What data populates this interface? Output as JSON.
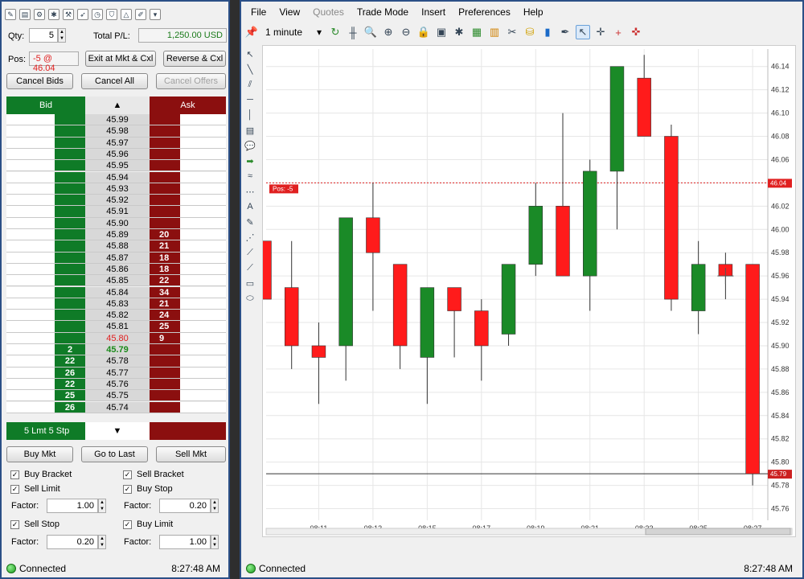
{
  "left_panel": {
    "toolbar_icons": [
      "pencil-icon",
      "document-icon",
      "gear-icon",
      "bug-icon",
      "tools-icon",
      "rocket-icon",
      "clock-icon",
      "shield-icon",
      "triangle-icon",
      "brush-icon",
      "dropdown-icon"
    ],
    "qty_label": "Qty:",
    "qty_value": "5",
    "total_pl_label": "Total P/L:",
    "total_pl_value": "1,250.00 USD",
    "pos_label": "Pos:",
    "pos_value": "-5 @ 46.04",
    "exit_button": "Exit at Mkt & Cxl",
    "reverse_button": "Reverse & Cxl",
    "cancel_bids": "Cancel Bids",
    "cancel_all": "Cancel All",
    "cancel_offers": "Cancel Offers",
    "bid_header": "Bid",
    "ask_header": "Ask",
    "up_arrow": "▲",
    "down_arrow": "▼",
    "footer_left": "5 Lmt 5 Stp",
    "ladder": [
      {
        "bid": "",
        "price": "45.99",
        "ask": ""
      },
      {
        "bid": "",
        "price": "45.98",
        "ask": ""
      },
      {
        "bid": "",
        "price": "45.97",
        "ask": ""
      },
      {
        "bid": "",
        "price": "45.96",
        "ask": ""
      },
      {
        "bid": "",
        "price": "45.95",
        "ask": ""
      },
      {
        "bid": "",
        "price": "45.94",
        "ask": ""
      },
      {
        "bid": "",
        "price": "45.93",
        "ask": ""
      },
      {
        "bid": "",
        "price": "45.92",
        "ask": ""
      },
      {
        "bid": "",
        "price": "45.91",
        "ask": ""
      },
      {
        "bid": "",
        "price": "45.90",
        "ask": ""
      },
      {
        "bid": "",
        "price": "45.89",
        "ask": "20"
      },
      {
        "bid": "",
        "price": "45.88",
        "ask": "21"
      },
      {
        "bid": "",
        "price": "45.87",
        "ask": "18"
      },
      {
        "bid": "",
        "price": "45.86",
        "ask": "18"
      },
      {
        "bid": "",
        "price": "45.85",
        "ask": "22"
      },
      {
        "bid": "",
        "price": "45.84",
        "ask": "34"
      },
      {
        "bid": "",
        "price": "45.83",
        "ask": "21"
      },
      {
        "bid": "",
        "price": "45.82",
        "ask": "24"
      },
      {
        "bid": "",
        "price": "45.81",
        "ask": "25"
      },
      {
        "bid": "",
        "price": "45.80",
        "ask": "9"
      },
      {
        "bid": "2",
        "price": "45.79",
        "ask": ""
      },
      {
        "bid": "22",
        "price": "45.78",
        "ask": ""
      },
      {
        "bid": "26",
        "price": "45.77",
        "ask": ""
      },
      {
        "bid": "22",
        "price": "45.76",
        "ask": ""
      },
      {
        "bid": "25",
        "price": "45.75",
        "ask": ""
      },
      {
        "bid": "26",
        "price": "45.74",
        "ask": ""
      }
    ],
    "buy_mkt": "Buy Mkt",
    "go_to_last": "Go to Last",
    "sell_mkt": "Sell Mkt",
    "buy_bracket": "Buy Bracket",
    "sell_bracket": "Sell Bracket",
    "sell_limit": "Sell Limit",
    "buy_stop": "Buy Stop",
    "factor_label": "Factor:",
    "factor1": "1.00",
    "factor2": "0.20",
    "sell_stop": "Sell Stop",
    "buy_limit": "Buy Limit",
    "factor3": "0.20",
    "factor4": "1.00",
    "status": "Connected",
    "time": "8:27:48 AM"
  },
  "right_panel": {
    "menu": [
      "File",
      "View",
      "Quotes",
      "Trade Mode",
      "Insert",
      "Preferences",
      "Help"
    ],
    "interval": "1 minute",
    "toolbar_icons": [
      "pin-icon",
      "refresh-icon",
      "bars-icon",
      "zoom-icon",
      "zoom-in-icon",
      "zoom-out-icon",
      "lock-icon",
      "image-icon",
      "bug-icon",
      "chart-icon",
      "grid-icon",
      "scissors-icon",
      "bucket-icon",
      "book-icon",
      "pen-icon",
      "cursor-icon",
      "crosshair-icon",
      "plus-icon",
      "target-icon"
    ],
    "side_icons": [
      "arrow-icon",
      "line-icon",
      "channel-icon",
      "hline-icon",
      "vline-icon",
      "note-icon",
      "bubble-icon",
      "green-arrow-icon",
      "wave-icon",
      "dotted-icon",
      "text-icon",
      "pencil-icon",
      "fib-icon",
      "gann-icon",
      "ray-icon",
      "rect-icon",
      "ellipse-icon"
    ],
    "status": "Connected",
    "time": "8:27:48 AM"
  },
  "chart_data": {
    "type": "candlestick",
    "x": [
      "08:10",
      "08:11",
      "08:12",
      "08:13",
      "08:14",
      "08:15",
      "08:16",
      "08:17",
      "08:18",
      "08:19",
      "08:20",
      "08:21",
      "08:22",
      "08:23",
      "08:24",
      "08:25",
      "08:26",
      "08:27"
    ],
    "xticks": [
      "08:11",
      "08:13",
      "08:15",
      "08:17",
      "08:19",
      "08:21",
      "08:23",
      "08:25",
      "08:27"
    ],
    "yticks": [
      "46.14",
      "46.12",
      "46.10",
      "46.08",
      "46.06",
      "46.04",
      "46.02",
      "46.00",
      "45.98",
      "45.96",
      "45.94",
      "45.92",
      "45.90",
      "45.88",
      "45.86",
      "45.84",
      "45.82",
      "45.80",
      "45.78",
      "45.76"
    ],
    "ylim": [
      45.75,
      46.155
    ],
    "candles": [
      {
        "o": 45.99,
        "h": 45.99,
        "l": 45.94,
        "c": 45.94
      },
      {
        "o": 45.95,
        "h": 45.99,
        "l": 45.88,
        "c": 45.9
      },
      {
        "o": 45.9,
        "h": 45.92,
        "l": 45.85,
        "c": 45.89
      },
      {
        "o": 45.9,
        "h": 46.01,
        "l": 45.87,
        "c": 46.01
      },
      {
        "o": 46.01,
        "h": 46.04,
        "l": 45.93,
        "c": 45.98
      },
      {
        "o": 45.97,
        "h": 45.97,
        "l": 45.88,
        "c": 45.9
      },
      {
        "o": 45.89,
        "h": 45.95,
        "l": 45.85,
        "c": 45.95
      },
      {
        "o": 45.95,
        "h": 45.95,
        "l": 45.89,
        "c": 45.93
      },
      {
        "o": 45.93,
        "h": 45.94,
        "l": 45.87,
        "c": 45.9
      },
      {
        "o": 45.91,
        "h": 45.97,
        "l": 45.9,
        "c": 45.97
      },
      {
        "o": 45.97,
        "h": 46.04,
        "l": 45.96,
        "c": 46.02
      },
      {
        "o": 46.02,
        "h": 46.1,
        "l": 45.96,
        "c": 45.96
      },
      {
        "o": 45.96,
        "h": 46.06,
        "l": 45.93,
        "c": 46.05
      },
      {
        "o": 46.05,
        "h": 46.14,
        "l": 46.0,
        "c": 46.14
      },
      {
        "o": 46.13,
        "h": 46.15,
        "l": 46.08,
        "c": 46.08
      },
      {
        "o": 46.08,
        "h": 46.09,
        "l": 45.93,
        "c": 45.94
      },
      {
        "o": 45.93,
        "h": 45.99,
        "l": 45.91,
        "c": 45.97
      },
      {
        "o": 45.97,
        "h": 45.98,
        "l": 45.94,
        "c": 45.96
      },
      {
        "o": 45.97,
        "h": 45.97,
        "l": 45.78,
        "c": 45.79
      }
    ],
    "pos_line": 46.04,
    "pos_label": "Pos: -5",
    "pos_price": "46.04",
    "last_line": 45.79,
    "last_price": "45.79",
    "colors": {
      "up": "#1a8a27",
      "down": "#ff1b1b",
      "pos": "#e02020"
    }
  }
}
